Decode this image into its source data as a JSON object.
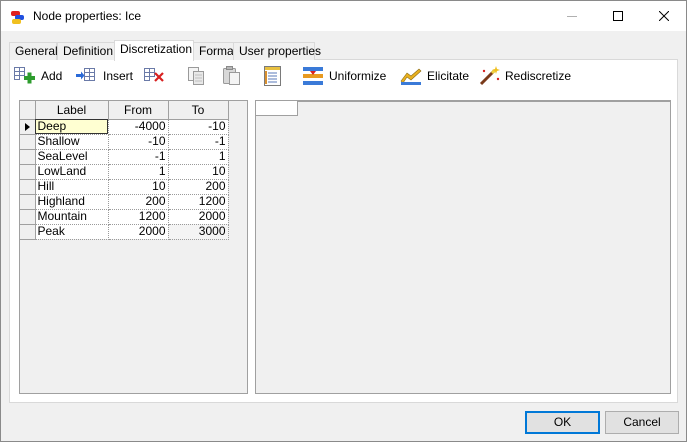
{
  "window": {
    "title": "Node properties: Ice",
    "controls": [
      "minimize",
      "maximize",
      "close"
    ]
  },
  "tabs": [
    {
      "label": "General",
      "active": false
    },
    {
      "label": "Definition",
      "active": false
    },
    {
      "label": "Discretization",
      "active": true
    },
    {
      "label": "Format",
      "active": false
    },
    {
      "label": "User properties",
      "active": false
    }
  ],
  "toolbar": {
    "add_label": "Add",
    "insert_label": "Insert",
    "uniformize_label": "Uniformize",
    "elicitate_label": "Elicitate",
    "rediscretize_label": "Rediscretize"
  },
  "table": {
    "columns": [
      "Label",
      "From",
      "To"
    ],
    "rows": [
      {
        "label": "Deep",
        "from": "-4000",
        "to": "-10"
      },
      {
        "label": "Shallow",
        "from": "-10",
        "to": "-1"
      },
      {
        "label": "SeaLevel",
        "from": "-1",
        "to": "1"
      },
      {
        "label": "LowLand",
        "from": "1",
        "to": "10"
      },
      {
        "label": "Hill",
        "from": "10",
        "to": "200"
      },
      {
        "label": "Highland",
        "from": "200",
        "to": "1200"
      },
      {
        "label": "Mountain",
        "from": "1200",
        "to": "2000"
      },
      {
        "label": "Peak",
        "from": "2000",
        "to": "3000"
      }
    ],
    "selected_row": 0
  },
  "buttons": {
    "ok_label": "OK",
    "cancel_label": "Cancel"
  },
  "colors": {
    "accent": "#0078d7",
    "selected_cell": "#ffffd2"
  }
}
